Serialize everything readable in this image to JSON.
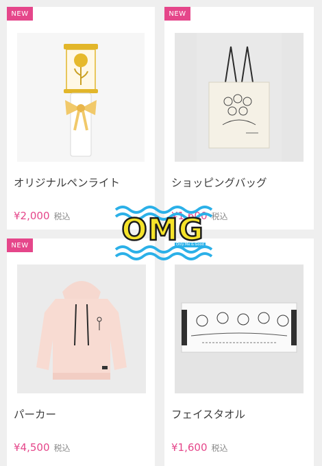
{
  "products": [
    {
      "badge": "NEW",
      "name": "オリジナルペンライト",
      "price": "¥2,000",
      "tax": "税込",
      "icon": "penlight-image"
    },
    {
      "badge": "NEW",
      "name": "ショッピングバッグ",
      "price": "¥1,600",
      "tax": "税込",
      "icon": "tote-bag-image"
    },
    {
      "badge": "NEW",
      "name": "パーカー",
      "price": "¥4,500",
      "tax": "税込",
      "icon": "hoodie-image"
    },
    {
      "badge": "",
      "name": "フェイスタオル",
      "price": "¥1,600",
      "tax": "税込",
      "icon": "towel-image"
    }
  ],
  "sticker": {
    "text": "OMG",
    "subtext": "Only Me & Good"
  },
  "colors": {
    "accent": "#e5468a",
    "sticker_yellow": "#f5e32a",
    "sticker_blue": "#2bb0e8",
    "background": "#efefef"
  }
}
